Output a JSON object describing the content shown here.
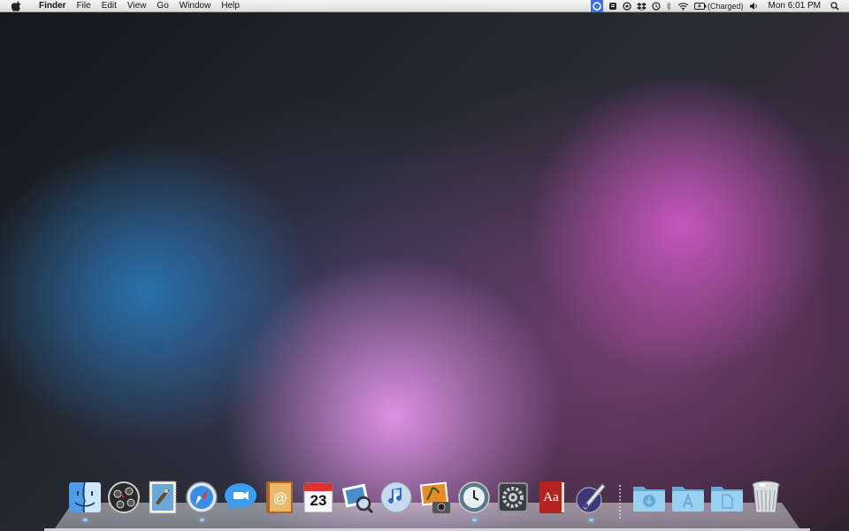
{
  "menubar": {
    "app_name": "Finder",
    "menus": [
      "File",
      "Edit",
      "View",
      "Go",
      "Window",
      "Help"
    ],
    "status": {
      "battery_text": "(Charged)",
      "clock": "Mon 6:01 PM"
    }
  },
  "dock": {
    "apps": [
      {
        "name": "Finder",
        "icon": "finder-icon",
        "running": true
      },
      {
        "name": "Dashboard",
        "icon": "dashboard-icon",
        "running": false
      },
      {
        "name": "Mail",
        "icon": "mail-icon",
        "running": false
      },
      {
        "name": "Safari",
        "icon": "safari-icon",
        "running": true
      },
      {
        "name": "iChat",
        "icon": "ichat-icon",
        "running": false
      },
      {
        "name": "Address Book",
        "icon": "address-book-icon",
        "running": false
      },
      {
        "name": "iCal",
        "icon": "ical-icon",
        "running": false,
        "date": "23"
      },
      {
        "name": "Preview",
        "icon": "preview-icon",
        "running": false
      },
      {
        "name": "iTunes",
        "icon": "itunes-icon",
        "running": false
      },
      {
        "name": "iPhoto",
        "icon": "iphoto-icon",
        "running": false
      },
      {
        "name": "Time Machine",
        "icon": "time-machine-icon",
        "running": true
      },
      {
        "name": "System Preferences",
        "icon": "system-preferences-icon",
        "running": false
      },
      {
        "name": "Dictionary",
        "icon": "dictionary-icon",
        "running": false,
        "label": "Aa"
      },
      {
        "name": "Script Editor",
        "icon": "script-editor-icon",
        "running": true
      }
    ],
    "folders": [
      {
        "name": "Downloads",
        "icon": "downloads-folder-icon"
      },
      {
        "name": "Applications",
        "icon": "applications-folder-icon"
      },
      {
        "name": "Documents",
        "icon": "documents-folder-icon"
      },
      {
        "name": "Trash",
        "icon": "trash-icon"
      }
    ]
  },
  "colors": {
    "menubar_active": "#3f6fe0",
    "dock_indicator": "#8fd4ff",
    "folder_blue": "#8ec8ea"
  }
}
